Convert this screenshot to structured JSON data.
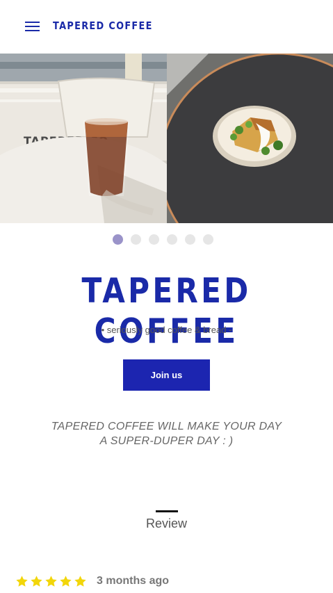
{
  "header": {
    "brand": "TAPERED COFFEE",
    "menu_icon": "hamburger-menu-icon",
    "brand_color": "#1a2aa8"
  },
  "gallery": {
    "slides": [
      {
        "subject": "iced coffee on white table",
        "sign_text": "TAPERED CO"
      },
      {
        "subject": "slice of cake with cream and herbs on plate"
      }
    ],
    "dots_count": 6,
    "active_dot": 1,
    "active_color": "#9a93c9",
    "inactive_color": "#e6e6e6"
  },
  "hero": {
    "title": "TAPERED COFFEE",
    "tagline": "• seriously good coffee & bread -",
    "join_label": "Join us",
    "button_color": "#1c25b0",
    "promo_line1": "TAPERED COFFEE WILL MAKE YOUR DAY",
    "promo_line2": "A SUPER-DUPER DAY : )"
  },
  "review_section": {
    "title": "Review",
    "rating": 5,
    "star_color": "#f2d60a",
    "time": "3 months ago"
  }
}
